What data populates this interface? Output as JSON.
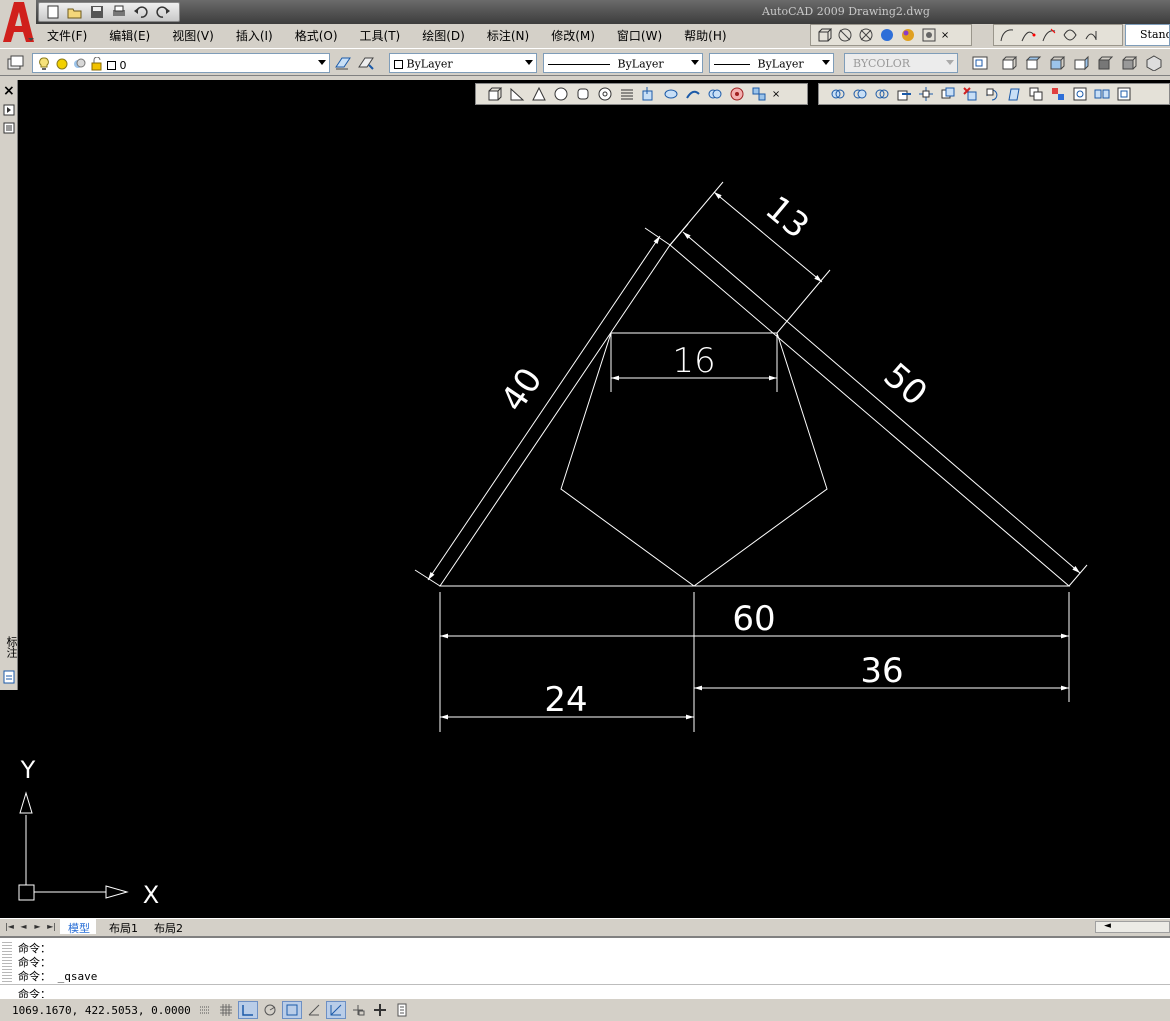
{
  "window": {
    "title": "AutoCAD 2009 Drawing2.dwg"
  },
  "menu": [
    {
      "label": "文件(F)"
    },
    {
      "label": "编辑(E)"
    },
    {
      "label": "视图(V)"
    },
    {
      "label": "插入(I)"
    },
    {
      "label": "格式(O)"
    },
    {
      "label": "工具(T)"
    },
    {
      "label": "绘图(D)"
    },
    {
      "label": "标注(N)"
    },
    {
      "label": "修改(M)"
    },
    {
      "label": "窗口(W)"
    },
    {
      "label": "帮助(H)"
    }
  ],
  "toolbar": {
    "text_style": "Stand"
  },
  "properties": {
    "layer_value": "0",
    "color_value": "ByLayer",
    "linetype_value": "ByLayer",
    "lineweight_value": "ByLayer",
    "plotstyle_value": "BYCOLOR"
  },
  "drawing": {
    "dimensions": {
      "dim_13": "13",
      "dim_16": "16",
      "dim_40": "40",
      "dim_50": "50",
      "dim_60": "60",
      "dim_36": "36",
      "dim_24": "24"
    },
    "ucs": {
      "x_label": "X",
      "y_label": "Y"
    }
  },
  "left_panel": {
    "vertical_label": "标注"
  },
  "tabs": [
    {
      "label": "模型",
      "active": true
    },
    {
      "label": "布局1",
      "active": false
    },
    {
      "label": "布局2",
      "active": false
    }
  ],
  "command": {
    "history": [
      "命令：",
      "命令：",
      "命令： _qsave"
    ],
    "prompt": "命令："
  },
  "status": {
    "coordinates": "1069.1670,  422.5053,  0.0000"
  },
  "colors": {
    "canvas": "#000000",
    "geometry": "#ffffff",
    "active_tab": "#2a6fd6",
    "app_logo": "#d0201c"
  }
}
